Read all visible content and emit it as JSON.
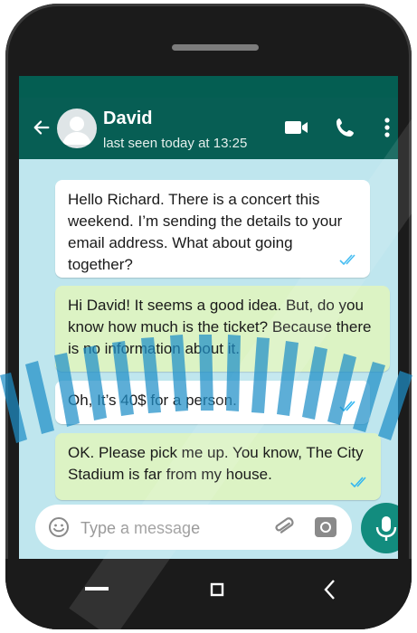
{
  "colors": {
    "header": "#075e54",
    "screen_background": "#bfe6ee",
    "incoming_bubble": "#ffffff",
    "outgoing_bubble": "#dcf3c4",
    "read_ticks": "#34b7f1",
    "mic_button": "#128c7e"
  },
  "header": {
    "contact_name": "David",
    "status": "last seen today at 13:25",
    "icons": [
      "back-arrow-icon",
      "avatar",
      "video-call-icon",
      "phone-call-icon",
      "more-options-icon"
    ]
  },
  "messages": [
    {
      "direction": "incoming",
      "text": "Hello Richard. There is a concert this weekend. I’m sending the details to your email address. What about going together?",
      "read": true
    },
    {
      "direction": "outgoing",
      "text": "Hi David! It seems a good idea. But, do you know how much is the ticket? Because there is no information about it.",
      "read": false
    },
    {
      "direction": "incoming",
      "text": "Oh, It’s 40$ for a person.",
      "read": true
    },
    {
      "direction": "outgoing",
      "text": "OK. Please pick me up. You know, The City Stadium is far from my house.",
      "read": true
    }
  ],
  "composer": {
    "placeholder": "Type a message",
    "icons": [
      "emoji-icon",
      "attach-icon",
      "camera-icon",
      "microphone-icon"
    ]
  },
  "nav_bar": {
    "icons": [
      "recent-apps-icon",
      "home-icon",
      "back-icon"
    ]
  }
}
